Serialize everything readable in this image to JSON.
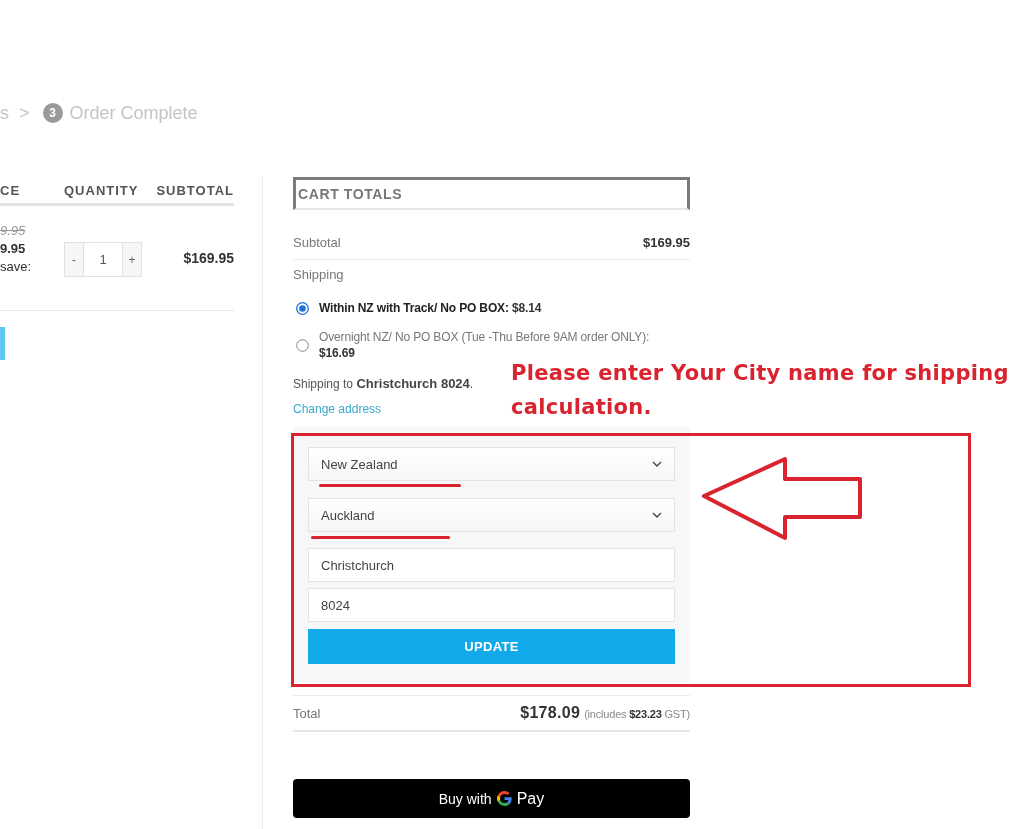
{
  "breadcrumb": {
    "previous_step_fragment": "s",
    "separator": ">",
    "current_step": {
      "number": "3",
      "label": "Order Complete"
    }
  },
  "cart_table": {
    "columns": [
      "CE",
      "QUANTITY",
      "SUBTOTAL"
    ],
    "rows": [
      {
        "regular_price": "9.95",
        "sale_price": "9.95",
        "savings_label": "save:",
        "decrease": "-",
        "quantity": "1",
        "increase": "+",
        "subtotal": "$169.95"
      }
    ]
  },
  "cart_totals": {
    "title": "CART TOTALS",
    "subtotal": {
      "label": "Subtotal",
      "value": "$169.95"
    },
    "shipping": {
      "label": "Shipping",
      "options": [
        {
          "label": "Within NZ with Track/ No PO BOX:",
          "price": "$8.14",
          "selected": true
        },
        {
          "label": "Overnight NZ/ No PO BOX (Tue -Thu Before 9AM order ONLY):",
          "price": "$16.69",
          "selected": false
        }
      ],
      "destination": "Shipping to **Christchurch 8024**.",
      "change_link": "Change address"
    },
    "calculator": {
      "country": "New Zealand",
      "region": "Auckland",
      "city": "Christchurch",
      "postcode": "8024",
      "button": "UPDATE"
    },
    "total": {
      "label": "Total",
      "value": "$178.09",
      "tax_note": "(includes **$23.23** GST)"
    }
  },
  "gpay_button": {
    "label_before": "Buy with",
    "label_after": "Pay"
  },
  "annotation": {
    "text": "Please enter Your City name for shipping calculation."
  }
}
